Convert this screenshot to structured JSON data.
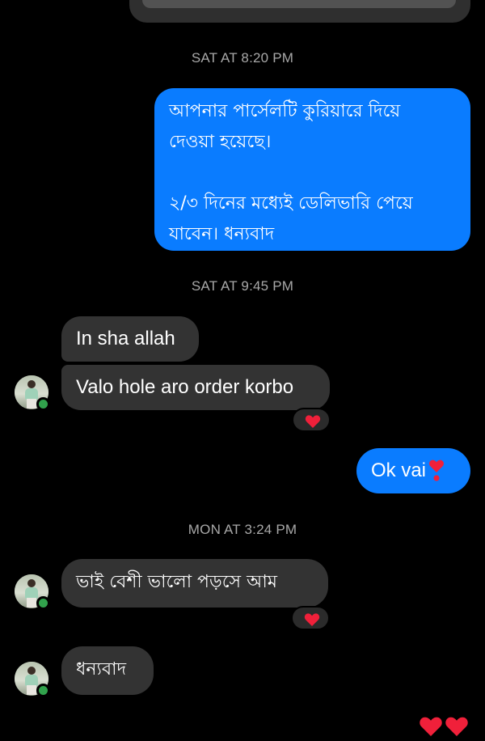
{
  "colors": {
    "outgoing_bubble": "#0a7cff",
    "incoming_bubble": "#333333",
    "timestamp_text": "#a8a8a8",
    "online_dot": "#31a24c",
    "heart": "#f0203a"
  },
  "thread": {
    "timestamps": [
      "SAT AT 8:20 PM",
      "SAT AT 9:45 PM",
      "MON AT 3:24 PM"
    ],
    "messages": [
      {
        "direction": "outgoing",
        "text": "আপনার পার্সেলটি কুরিয়ারে দিয়ে\nদেওয়া হয়েছে।\n\n২/৩ দিনের মধ্যেই ডেলিভারি পেয়ে\nযাবেন। ধন্যবাদ"
      },
      {
        "direction": "incoming",
        "text": "In sha allah"
      },
      {
        "direction": "incoming",
        "text": "Valo hole aro order korbo",
        "reaction": "heart-icon"
      },
      {
        "direction": "outgoing",
        "text": "Ok vai",
        "emoji": "heart-exclamation-icon"
      },
      {
        "direction": "incoming",
        "text": "ভাই বেশী ভালো পড়সে আম",
        "reaction": "heart-icon"
      },
      {
        "direction": "incoming",
        "text": "ধন্যবাদ"
      }
    ]
  }
}
